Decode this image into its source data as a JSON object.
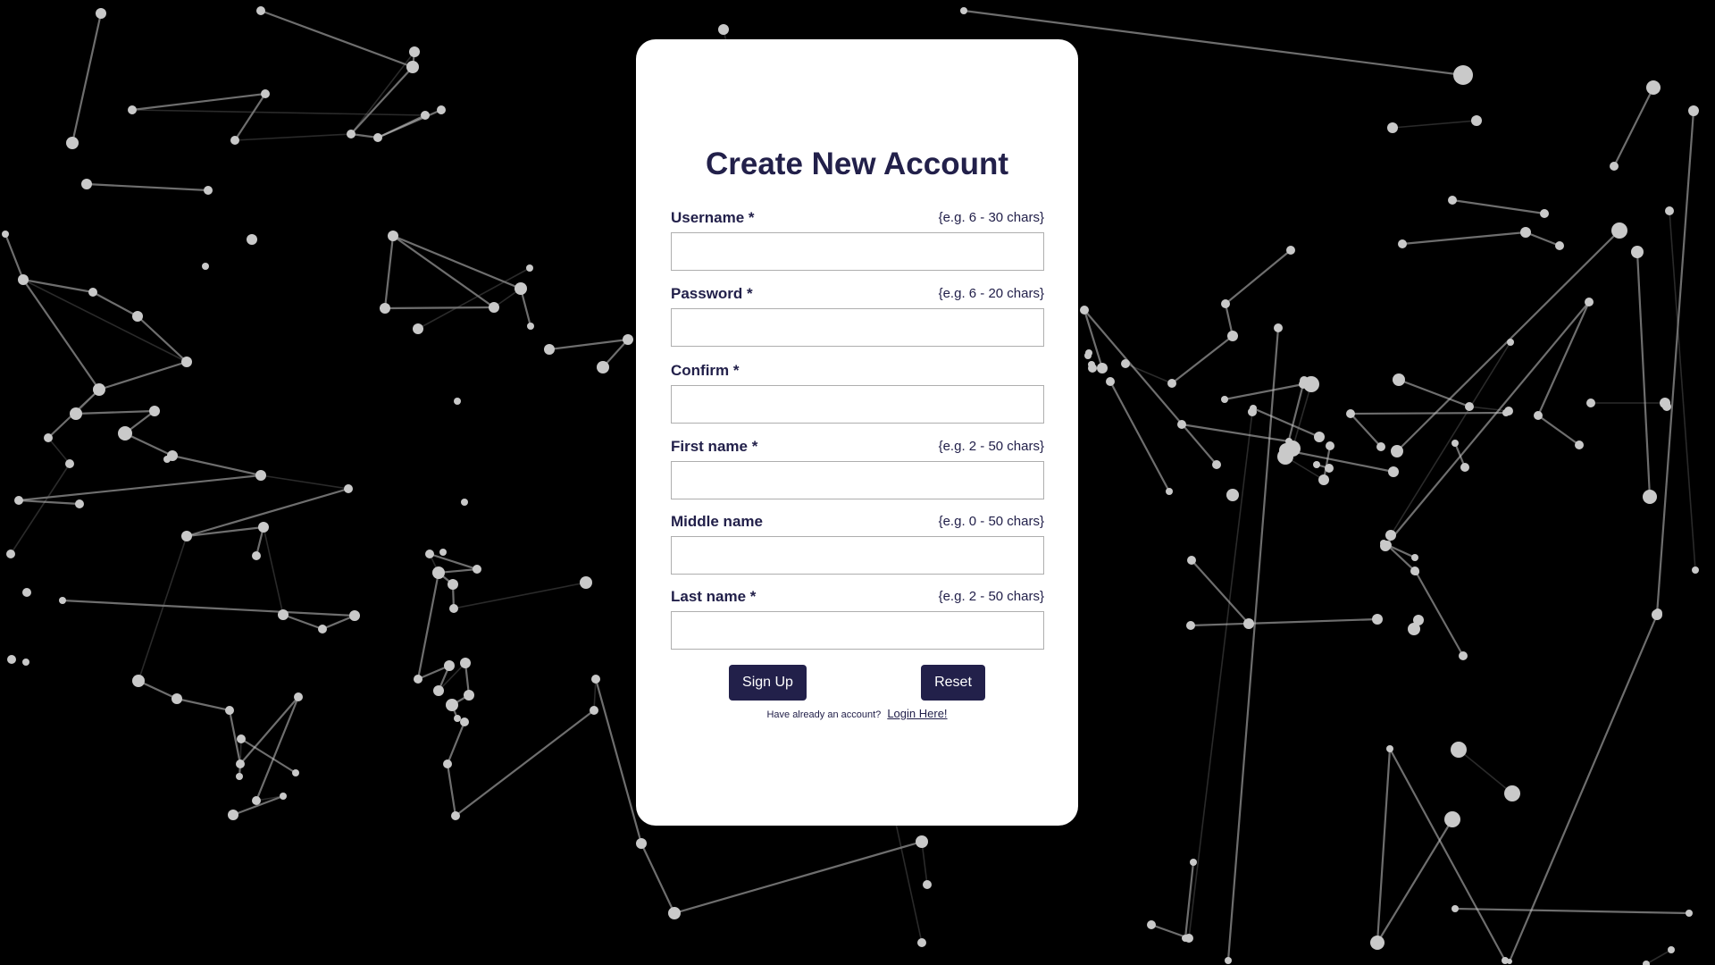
{
  "form": {
    "title": "Create New Account",
    "fields": [
      {
        "label": "Username *",
        "hint": "{e.g. 6 - 30 chars}",
        "value": ""
      },
      {
        "label": "Password *",
        "hint": "{e.g. 6 - 20 chars}",
        "value": ""
      },
      {
        "label": "Confirm *",
        "hint": "",
        "value": ""
      },
      {
        "label": "First name *",
        "hint": "{e.g. 2 - 50 chars}",
        "value": ""
      },
      {
        "label": "Middle name",
        "hint": "{e.g. 0 - 50 chars}",
        "value": ""
      },
      {
        "label": "Last name *",
        "hint": "{e.g. 2 - 50 chars}",
        "value": ""
      }
    ],
    "signup_label": "Sign Up",
    "reset_label": "Reset",
    "footer_text": "Have already an account?",
    "login_link": "Login Here!"
  },
  "colors": {
    "background": "#000000",
    "card": "#ffffff",
    "accent": "#22204a",
    "particles": "#c9c9c9"
  }
}
